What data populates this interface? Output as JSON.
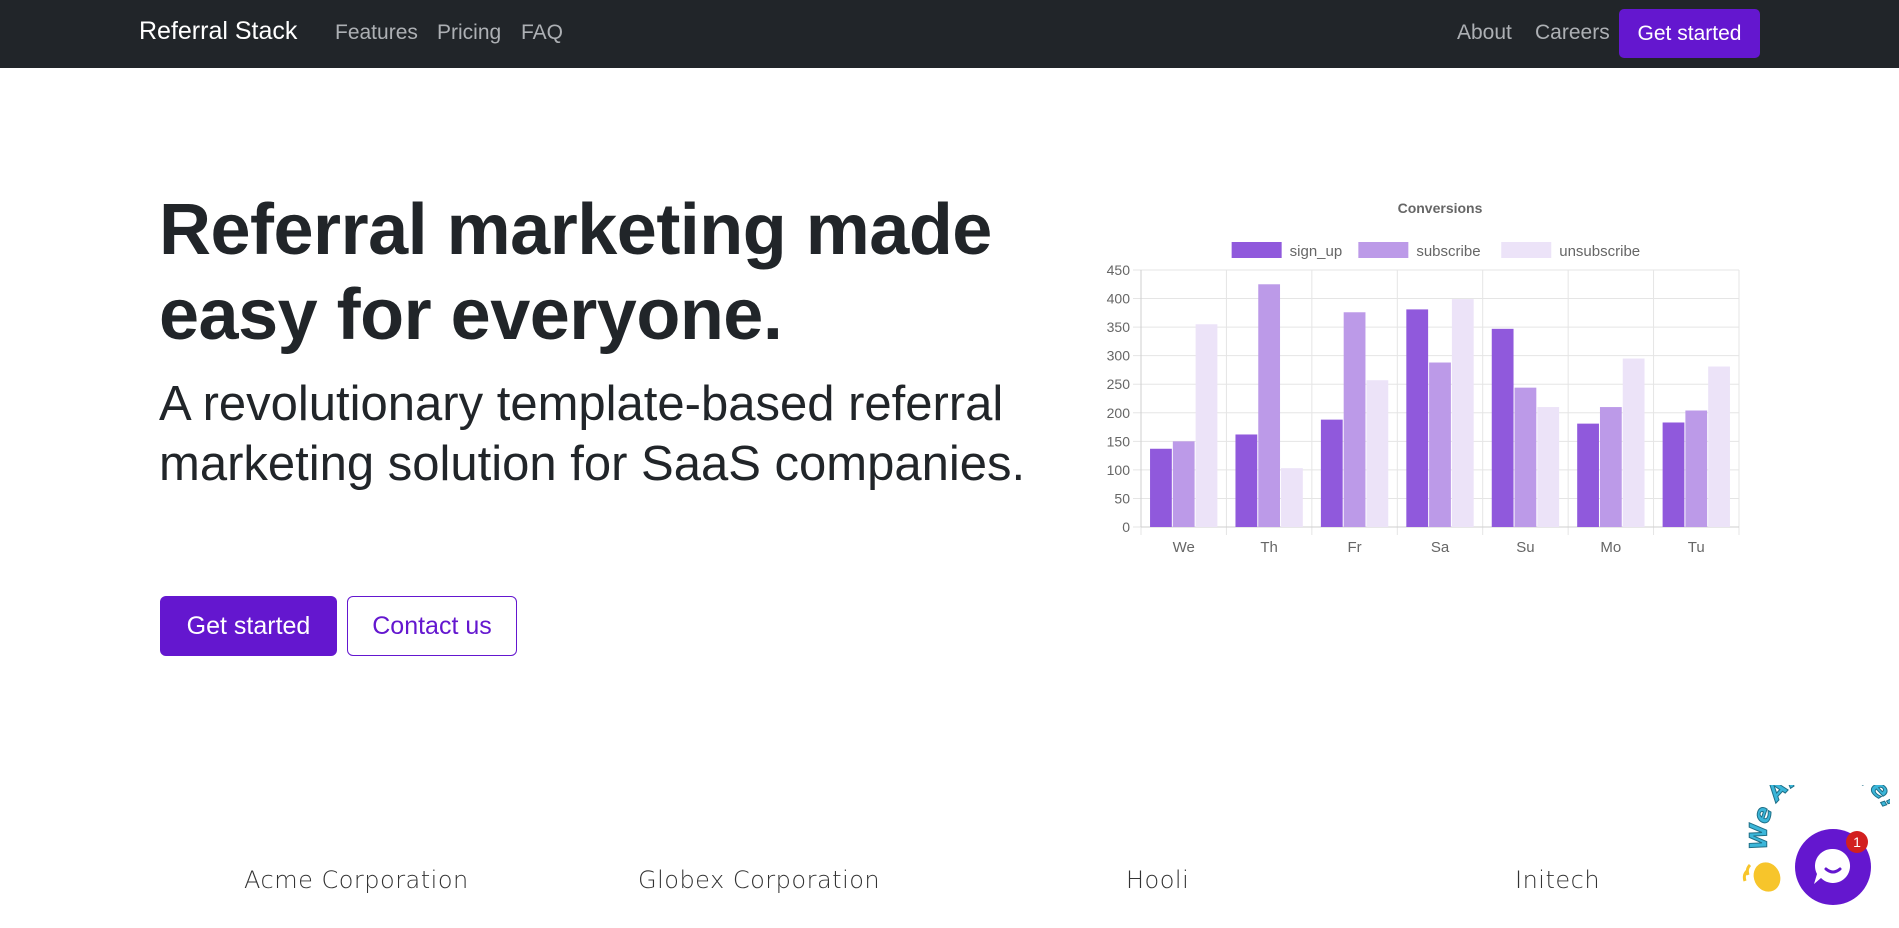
{
  "nav": {
    "brand": "Referral Stack",
    "left_links": [
      "Features",
      "Pricing",
      "FAQ"
    ],
    "right_links": [
      "About",
      "Careers"
    ],
    "cta": "Get started"
  },
  "hero": {
    "title": "Referral marketing made easy for everyone.",
    "lead": "A revolutionary template-based referral marketing solution for SaaS companies.",
    "primary_button": "Get started",
    "secondary_button": "Contact us"
  },
  "colors": {
    "navbar": "#212529",
    "brand_purple": "#6417cf",
    "series_sign_up": "#9059dc",
    "series_subscribe": "#bc9ae8",
    "series_unsubscribe": "#ece3f8"
  },
  "chart_data": {
    "type": "bar",
    "title": "Conversions",
    "categories": [
      "We",
      "Th",
      "Fr",
      "Sa",
      "Su",
      "Mo",
      "Tu"
    ],
    "series": [
      {
        "name": "sign_up",
        "values": [
          137,
          162,
          188,
          381,
          347,
          181,
          183
        ]
      },
      {
        "name": "subscribe",
        "values": [
          150,
          425,
          376,
          288,
          244,
          210,
          204
        ]
      },
      {
        "name": "unsubscribe",
        "values": [
          355,
          103,
          257,
          399,
          210,
          295,
          281
        ]
      }
    ],
    "ylim": [
      0,
      450
    ],
    "yticks": [
      "0",
      "50",
      "100",
      "150",
      "200",
      "250",
      "300",
      "350",
      "400",
      "450"
    ],
    "grid": true,
    "legend_position": "top"
  },
  "logos": [
    "Acme Corporation",
    "Globex Corporation",
    "Hooli",
    "Initech"
  ],
  "chat": {
    "banner": "We Are Here!",
    "badge_count": "1",
    "wave_icon": "waving-hand-icon"
  }
}
